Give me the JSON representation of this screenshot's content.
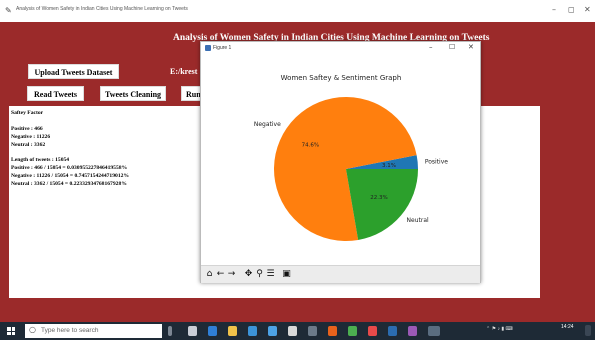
{
  "window": {
    "title": "Analysis of Women Safety in Indian Cities Using Machine Learning on Tweets",
    "controls": {
      "minimize": "–",
      "maximize": "◻",
      "close": "✕"
    }
  },
  "app": {
    "heading": "Analysis of Women Safety in Indian Cities Using Machine Learning on Tweets",
    "buttons": {
      "upload": "Upload Tweets Dataset",
      "read": "Read Tweets",
      "clean": "Tweets Cleaning",
      "run": "Run"
    },
    "path_label": "E:/krest"
  },
  "output": {
    "lines": [
      "Saftey Factor",
      "",
      "Positive : 466",
      "Negative : 11226",
      "Neutral  : 3362",
      "",
      "Length of tweets  : 15054",
      "Positive : 466 / 15054 = 0.030955227846419558%",
      "Negative : 11226 / 15054 = 0.7457154244719012%",
      "Neutral  : 3362 / 15054 = 0.22332934768167928%"
    ]
  },
  "figure": {
    "window_title": "Figure 1",
    "controls": {
      "minimize": "–",
      "maximize": "☐",
      "close": "✕"
    },
    "toolbar": [
      "home-icon",
      "back-icon",
      "forward-icon",
      "pan-icon",
      "zoom-icon",
      "configure-icon",
      "save-icon"
    ]
  },
  "chart_data": {
    "type": "pie",
    "title": "Women Saftey & Sentiment Graph",
    "slices": [
      {
        "label": "Positive",
        "value": 3.1,
        "pct_label": "3.1%",
        "color": "#1f77b4"
      },
      {
        "label": "Negative",
        "value": 74.6,
        "pct_label": "74.6%",
        "color": "#ff7f0e"
      },
      {
        "label": "Neutral",
        "value": 22.3,
        "pct_label": "22.3%",
        "color": "#2ca02c"
      }
    ]
  },
  "taskbar": {
    "search_placeholder": "Type here to search",
    "time": "14:24"
  },
  "colors": {
    "app_bg": "#9b2a2a",
    "taskbar": "#1e2a36"
  }
}
